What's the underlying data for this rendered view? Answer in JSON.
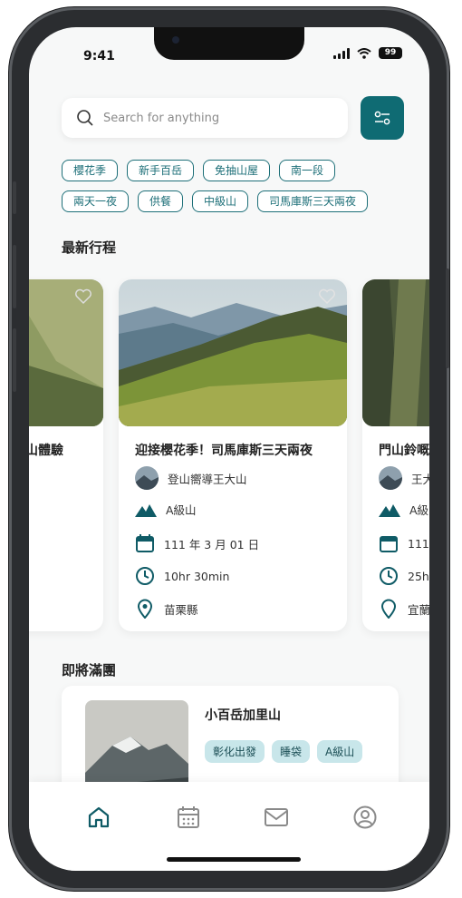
{
  "status": {
    "time": "9:41",
    "battery": "99"
  },
  "search": {
    "placeholder": "Search for anything"
  },
  "tags": {
    "row1": [
      "櫻花季",
      "新手百岳",
      "免抽山屋",
      "南一段"
    ],
    "row2": [
      "兩天一夜",
      "供餐",
      "中級山",
      "司馬庫斯三天兩夜"
    ]
  },
  "sections": {
    "latest": "最新行程",
    "upcoming": "即將滿團"
  },
  "cards": [
    {
      "title": "山體驗"
    },
    {
      "title": "迎接櫻花季！司馬庫斯三天兩夜",
      "guide": "登山嚮導王大山",
      "level": "A級山",
      "date": "111 年 3 月 01 日",
      "duration": "10hr  30min",
      "location": "苗栗縣"
    },
    {
      "title": "門山鈴嘅",
      "guide": "王大",
      "level": "A級",
      "date": "111",
      "duration": "25h",
      "location": "宜蘭"
    }
  ],
  "upcoming": {
    "name": "小百岳加里山",
    "chips": [
      "彰化出發",
      "睡袋",
      "A級山"
    ]
  },
  "tabs": [
    "home",
    "calendar",
    "mail",
    "profile"
  ],
  "colors": {
    "accent": "#0f6b73",
    "chip_bg": "#c8e6ea"
  }
}
